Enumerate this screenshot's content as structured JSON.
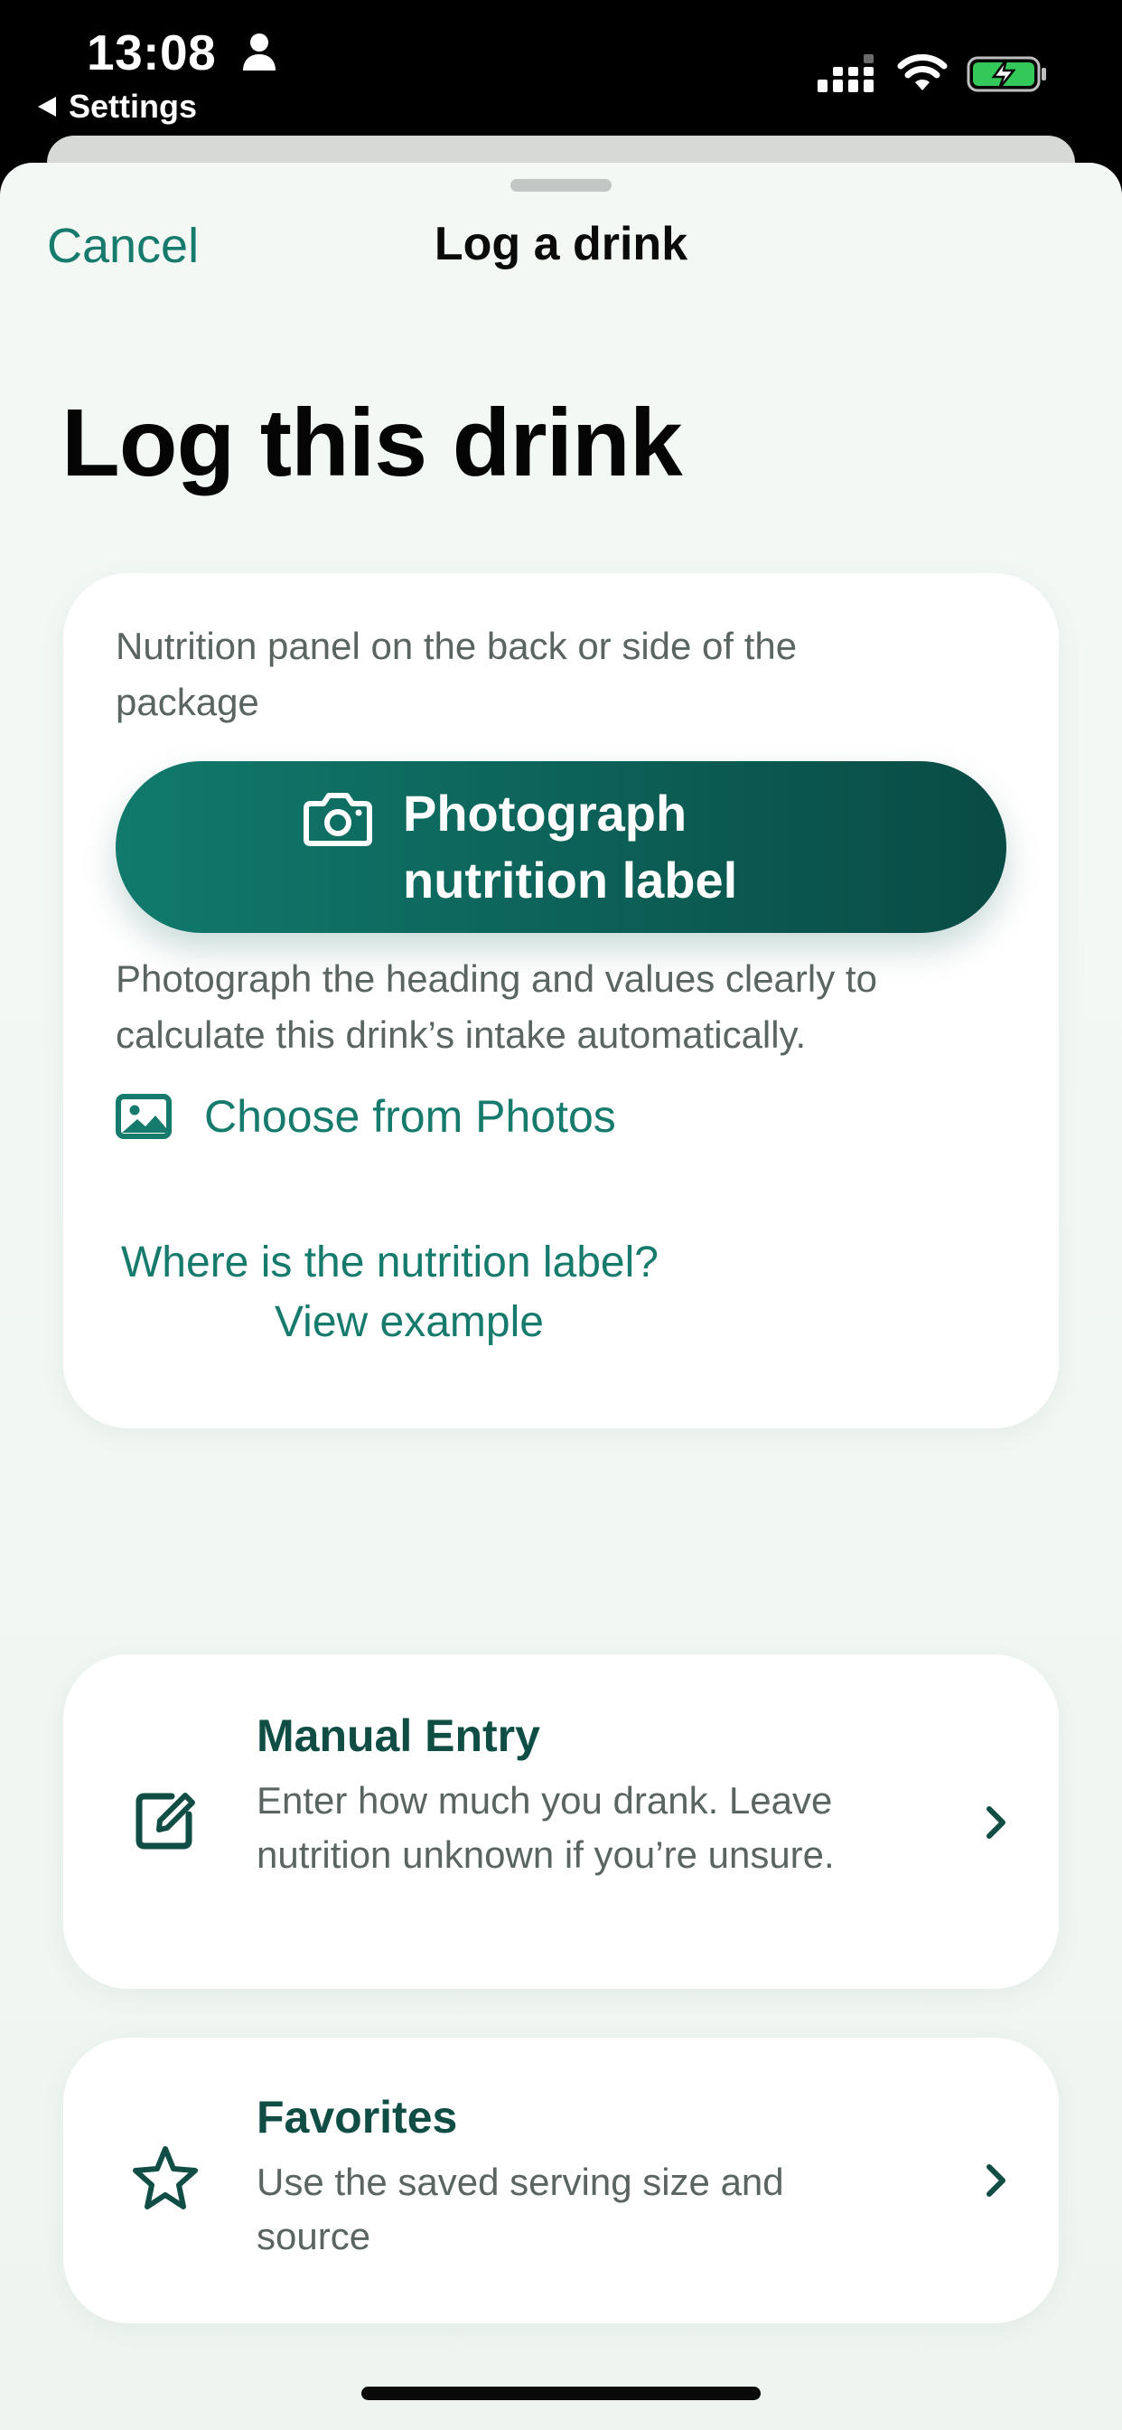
{
  "status_bar": {
    "time": "13:08",
    "back_label": "Settings"
  },
  "nav": {
    "cancel_label": "Cancel",
    "title": "Log a drink"
  },
  "page": {
    "title": "Log this drink"
  },
  "photo_card": {
    "description": "Nutrition panel on the back or side of the package",
    "primary_button_label": "Photograph nutrition label",
    "hint": "Photograph the heading and values clearly to calculate this drink’s intake automatically.",
    "choose_photos_label": "Choose from Photos",
    "where_line1": "Where is the nutrition label?",
    "where_line2": "View example"
  },
  "options": [
    {
      "title": "Manual Entry",
      "description": "Enter how much you drank. Leave nutrition unknown if you’re unsure.",
      "icon": "edit-square-icon"
    },
    {
      "title": "Favorites",
      "description": "Use the saved serving size and source",
      "icon": "star-icon"
    }
  ],
  "colors": {
    "accent": "#167a6c",
    "button_gradient_start": "#117a6d",
    "button_gradient_end": "#094b45",
    "title_dark_green": "#0f4d45",
    "sheet_background": "#f2f8f4",
    "battery_green": "#34c759"
  }
}
